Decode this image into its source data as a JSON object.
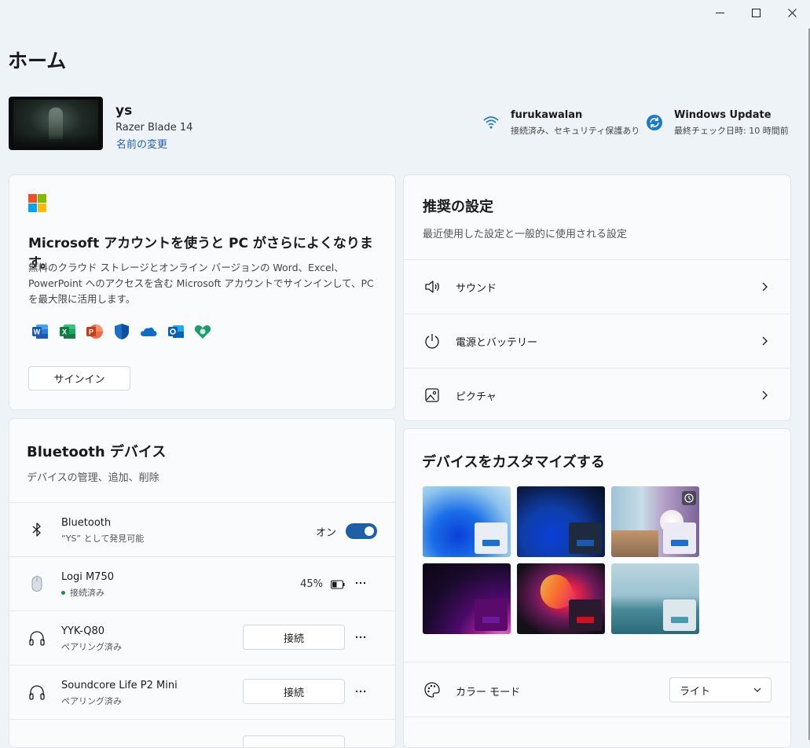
{
  "window": {
    "controls": [
      "minimize",
      "maximize",
      "close"
    ]
  },
  "header": {
    "title": "ホーム"
  },
  "device": {
    "name": "ys",
    "model": "Razer Blade 14",
    "rename_link": "名前の変更"
  },
  "status": {
    "network": {
      "icon": "wifi-icon",
      "title": "furukawalan",
      "subtitle": "接続済み、セキュリティ保護あり"
    },
    "update": {
      "icon": "sync-icon",
      "title": "Windows Update",
      "subtitle": "最終チェック日時: 10 時間前"
    }
  },
  "ms_account": {
    "title": "Microsoft アカウントを使うと PC がさらによくなります。",
    "description": "無料のクラウド ストレージとオンライン バージョンの Word、Excel、PowerPoint へのアクセスを含む Microsoft アカウントでサインインして、PC を最大限に活用します。",
    "apps": [
      "word-icon",
      "excel-icon",
      "powerpoint-icon",
      "defender-icon",
      "onedrive-icon",
      "outlook-icon",
      "family-icon"
    ],
    "signin_button": "サインイン",
    "logo_colors": [
      "#f25022",
      "#7fba00",
      "#00a4ef",
      "#ffb900"
    ]
  },
  "recommended": {
    "title": "推奨の設定",
    "subtitle": "最近使用した設定と一般的に使用される設定",
    "items": [
      {
        "label": "サウンド",
        "icon": "speaker-icon"
      },
      {
        "label": "電源とバッテリー",
        "icon": "power-icon"
      },
      {
        "label": "ピクチャ",
        "icon": "picture-icon"
      }
    ]
  },
  "bluetooth": {
    "title": "Bluetooth デバイス",
    "subtitle": "デバイスの管理、追加、削除",
    "toggle_row": {
      "name": "Bluetooth",
      "status": "“YS” として発見可能",
      "toggle_label": "オン",
      "toggle_on": true
    },
    "devices": [
      {
        "name": "Logi M750",
        "status": "接続済み",
        "battery": "45%",
        "connected": true,
        "icon": "mouse-icon"
      },
      {
        "name": "YYK-Q80",
        "status": "ペアリング済み",
        "connect_label": "接続",
        "icon": "headphones-icon"
      },
      {
        "name": "Soundcore Life P2 Mini",
        "status": "ペアリング済み",
        "connect_label": "接続",
        "icon": "headphones-icon"
      }
    ]
  },
  "customize": {
    "title": "デバイスをカスタマイズする",
    "color_mode_label": "カラー モード",
    "color_mode_value": "ライト",
    "accent_colors": [
      "#1a6fd0",
      "#1a5ab0",
      "#1a6fd0",
      "#5a0a7a",
      "#d01020",
      "#4a9ab0"
    ]
  }
}
